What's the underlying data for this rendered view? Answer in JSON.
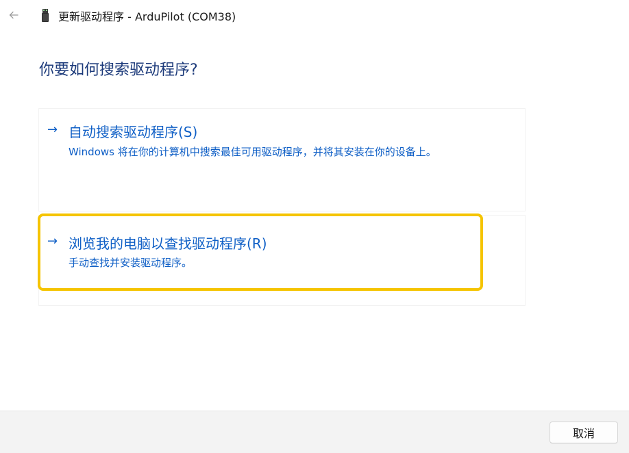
{
  "window": {
    "title": "更新驱动程序 - ArduPilot (COM38)"
  },
  "heading": "你要如何搜索驱动程序?",
  "options": [
    {
      "arrow": "→",
      "title": "自动搜索驱动程序(S)",
      "description": "Windows 将在你的计算机中搜索最佳可用驱动程序，并将其安装在你的设备上。"
    },
    {
      "arrow": "→",
      "title": "浏览我的电脑以查找驱动程序(R)",
      "description": "手动查找并安装驱动程序。"
    }
  ],
  "footer": {
    "cancel_label": "取消"
  },
  "colors": {
    "accent": "#0f5fc6",
    "heading": "#1c3a7a",
    "highlight": "#f5c400",
    "footer_bg": "#f3f3f3"
  },
  "icons": {
    "back": "back-arrow-icon",
    "device": "usb-device-icon"
  }
}
